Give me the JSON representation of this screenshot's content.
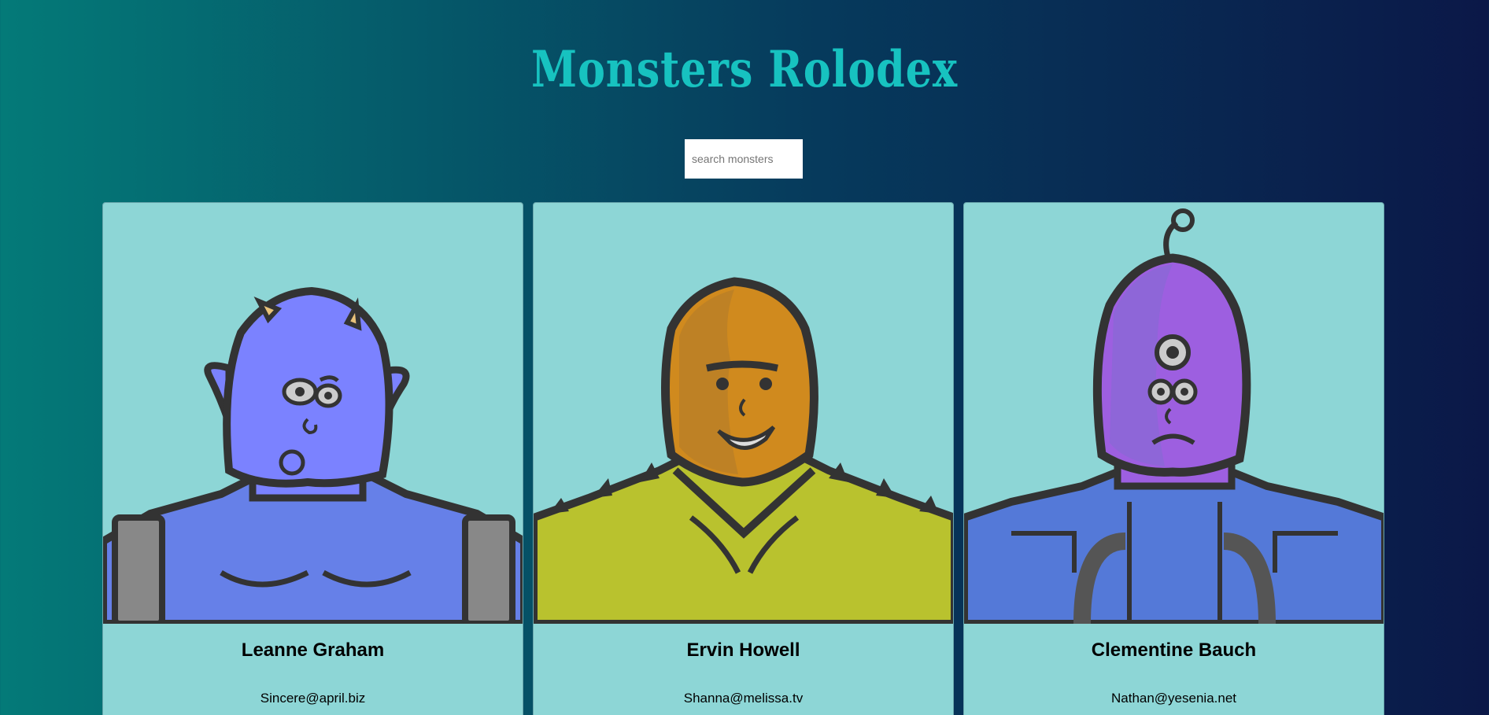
{
  "header": {
    "title": "Monsters Rolodex"
  },
  "search": {
    "placeholder": "search monsters",
    "value": ""
  },
  "monsters": [
    {
      "name": "Leanne Graham",
      "email": "Sincere@april.biz",
      "skin_color": "#7b82ff",
      "body_color": "#6680e8"
    },
    {
      "name": "Ervin Howell",
      "email": "Shanna@melissa.tv",
      "skin_color": "#d08a1e",
      "body_color": "#b9c22e"
    },
    {
      "name": "Clementine Bauch",
      "email": "Nathan@yesenia.net",
      "skin_color": "#9d5fe0",
      "body_color": "#5479d8"
    }
  ],
  "colors": {
    "card_background": "#8dd6d6",
    "title": "#17c2c0",
    "outline": "#333333"
  }
}
